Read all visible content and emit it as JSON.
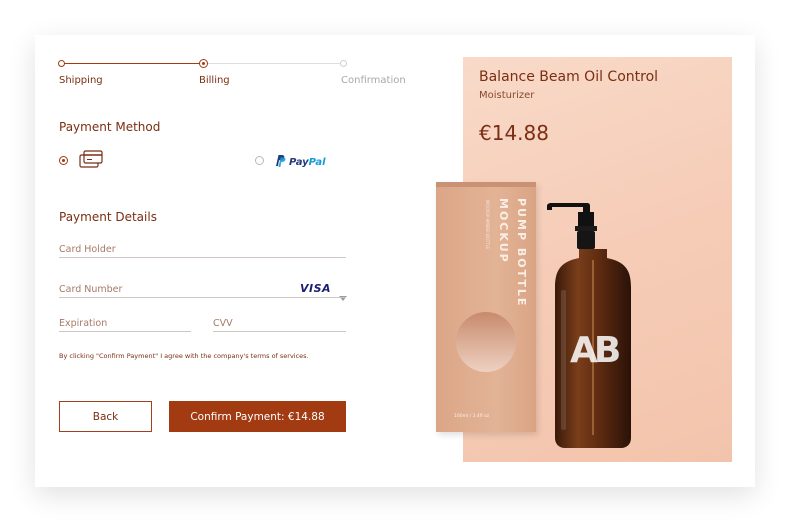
{
  "stepper": {
    "steps": [
      {
        "label": "Shipping",
        "state": "completed"
      },
      {
        "label": "Billing",
        "state": "current"
      },
      {
        "label": "Confirmation",
        "state": "upcoming"
      }
    ]
  },
  "payment_method": {
    "title": "Payment Method",
    "options": [
      {
        "name": "card",
        "icon": "credit-card-icon",
        "selected": true
      },
      {
        "name": "paypal",
        "label": "PayPal",
        "icon": "paypal-logo",
        "selected": false
      }
    ]
  },
  "payment_details": {
    "title": "Payment Details",
    "card_holder_placeholder": "Card Holder",
    "card_number_placeholder": "Card Number",
    "card_brand": "VISA",
    "expiration_placeholder": "Expiration",
    "cvv_placeholder": "CVV"
  },
  "terms_text": "By clicking \"Confirm Payment\" I agree with the company's terms of services.",
  "buttons": {
    "back_label": "Back",
    "confirm_label": "Confirm Payment: €14.88"
  },
  "product": {
    "name": "Balance Beam Oil Control",
    "subtitle": "Moisturizer",
    "price": "€14.88",
    "box_text_line1": "PUMP BOTTLE",
    "box_text_line2": "MOCKUP",
    "box_small_text": "MOCKUP AMBER BOTTLE",
    "box_volume": "100ml / 3.4fl oz",
    "bottle_logo": "AB"
  },
  "colors": {
    "accent": "#a23a12",
    "text": "#7a2e12",
    "panel": "#f6cdb8",
    "paypal_dark": "#253b80",
    "paypal_light": "#179bd7",
    "visa": "#1a1f71"
  }
}
